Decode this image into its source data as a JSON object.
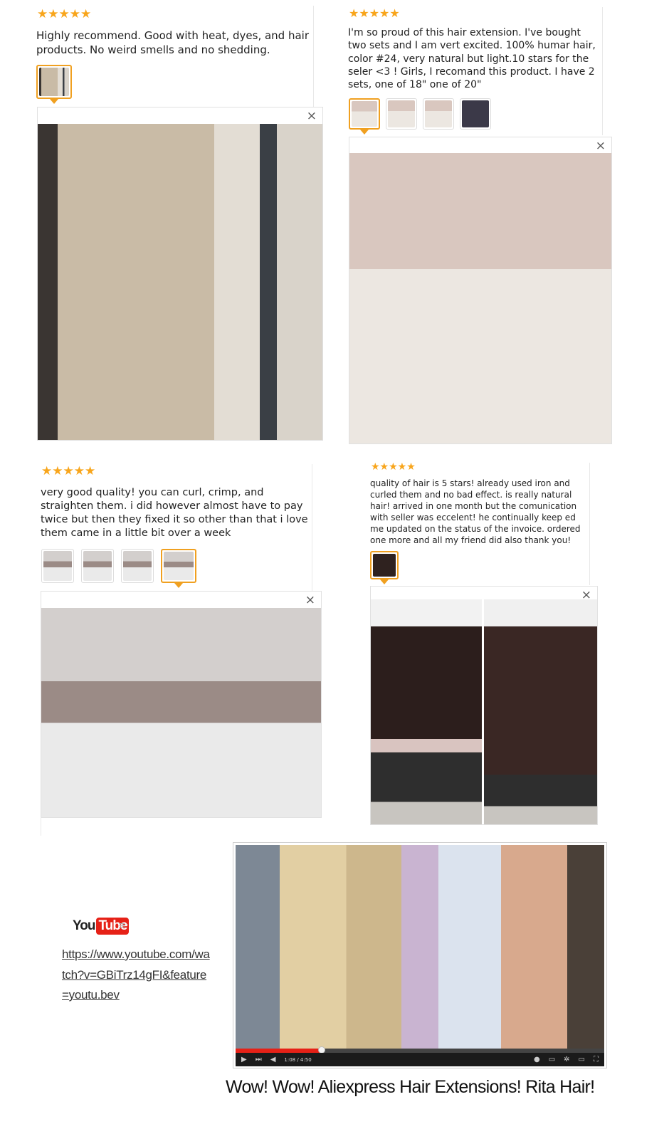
{
  "reviews": [
    {
      "rating": 5,
      "stars": "★★★★★",
      "text": "Highly recommend. Good with heat, dyes, and hair products. No weird smells and no shedding.",
      "thumbnails": 1,
      "active_thumbnail": 1,
      "close_label": "×"
    },
    {
      "rating": 5,
      "stars": "★★★★★",
      "text": "I'm so proud of this hair extension. I've bought two sets and I am vert excited. 100% humar hair, color #24, very natural but light.10 stars for the seler <3 ! Girls, I recomand this product. I have 2 sets, one of 18\" one of 20\"",
      "thumbnails": 4,
      "active_thumbnail": 1,
      "close_label": "×"
    },
    {
      "rating": 5,
      "stars": "★★★★★",
      "text": "very good quality! you can curl, crimp, and straighten them. i did however almost have to pay twice but then they fixed it so other than that i love them came in a little bit over a week",
      "thumbnails": 4,
      "active_thumbnail": 4,
      "close_label": "×"
    },
    {
      "rating": 5,
      "stars": "★★★★★",
      "text": "quality of hair is 5 stars! already used iron and curled them and no bad effect. is really natural hair! arrived in one month but the comunication with seller was eccelent! he continually keep ed me updated on the status of the invoice. ordered one more and all my friend did also thank you!",
      "thumbnails": 1,
      "active_thumbnail": 1,
      "close_label": "×"
    }
  ],
  "youtube": {
    "logo_you": "You",
    "logo_tube": "Tube",
    "menu_glyph": "≡·",
    "link": "https://www.youtube.com/watch?v=GBiTrz14gFI&feature=youtu.bev"
  },
  "video": {
    "time": "1:08 / 4:50",
    "progress": 0.234
  },
  "caption": "Wow! Wow! Aliexpress Hair Extensions! Rita Hair!",
  "colors": {
    "star": "#f8a51b",
    "active_thumb_border": "#f0a020",
    "youtube_red": "#e62117"
  }
}
